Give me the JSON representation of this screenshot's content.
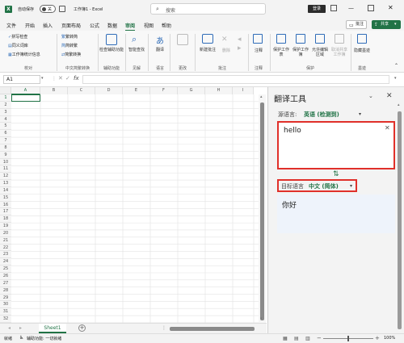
{
  "titlebar": {
    "autosave_label": "自动保存",
    "autosave_state": "关",
    "doc_title": "工作簿1 - Excel",
    "search_placeholder": "搜索",
    "login_label": "登录"
  },
  "menu": {
    "items": [
      "文件",
      "开始",
      "插入",
      "页面布局",
      "公式",
      "数据",
      "审阅",
      "视图",
      "帮助"
    ],
    "active": "审阅",
    "comment_btn": "批注",
    "share_btn": "共享"
  },
  "ribbon": {
    "spelling": "拼写检查",
    "thesaurus": "同义词库",
    "stats": "工作簿统计信息",
    "group_proofing": "校对",
    "trad2simp": "繁转简",
    "simp2trad": "简转繁",
    "convert": "简繁转换",
    "group_chinese": "中文简繁转换",
    "check_access": "检查辅助功能",
    "group_access": "辅助功能",
    "smart_lookup": "智能查找",
    "group_insights": "见解",
    "translate": "翻译",
    "group_language": "语言",
    "new_comment": "新建批注",
    "delete": "删除",
    "prev_comment": "上一条批注",
    "next_comment": "下一条批注",
    "show_comments": "显示批注",
    "group_comments": "批注",
    "notes": "注释",
    "group_notes": "注释",
    "protect_sheet": "保护工作表",
    "protect_workbook": "保护工作簿",
    "allow_edit": "允许编辑区域",
    "unshare": "取消共享工作簿",
    "group_protect": "保护",
    "hide_ink": "隐藏墨迹",
    "group_ink": "墨迹",
    "group_changes": "更改"
  },
  "formulabar": {
    "name_box": "A1",
    "fx": "fx",
    "value": ""
  },
  "sheet": {
    "columns": [
      "A",
      "B",
      "C",
      "D",
      "E",
      "F",
      "G",
      "H",
      "I"
    ],
    "rows": [
      "1",
      "2",
      "3",
      "4",
      "5",
      "6",
      "7",
      "8",
      "9",
      "10",
      "11",
      "12",
      "13",
      "14",
      "15",
      "16",
      "17",
      "18",
      "19",
      "20",
      "21",
      "22",
      "23",
      "24",
      "25",
      "26",
      "27",
      "28",
      "29",
      "30",
      "31",
      "32"
    ],
    "tab": "Sheet1"
  },
  "pane": {
    "title": "翻译工具",
    "source_label": "源语言:",
    "source_lang": "英语 (检测到)",
    "source_text": "hello",
    "target_label": "目标语言",
    "target_lang": "中文 (简体)",
    "target_text": "你好"
  },
  "statusbar": {
    "ready": "就绪",
    "accessibility": "辅助功能: 一切就绪",
    "zoom": "100%"
  },
  "colors": {
    "excel_green": "#217346",
    "highlight_red": "#e0302a",
    "pane_bg": "#f3f3f3"
  }
}
